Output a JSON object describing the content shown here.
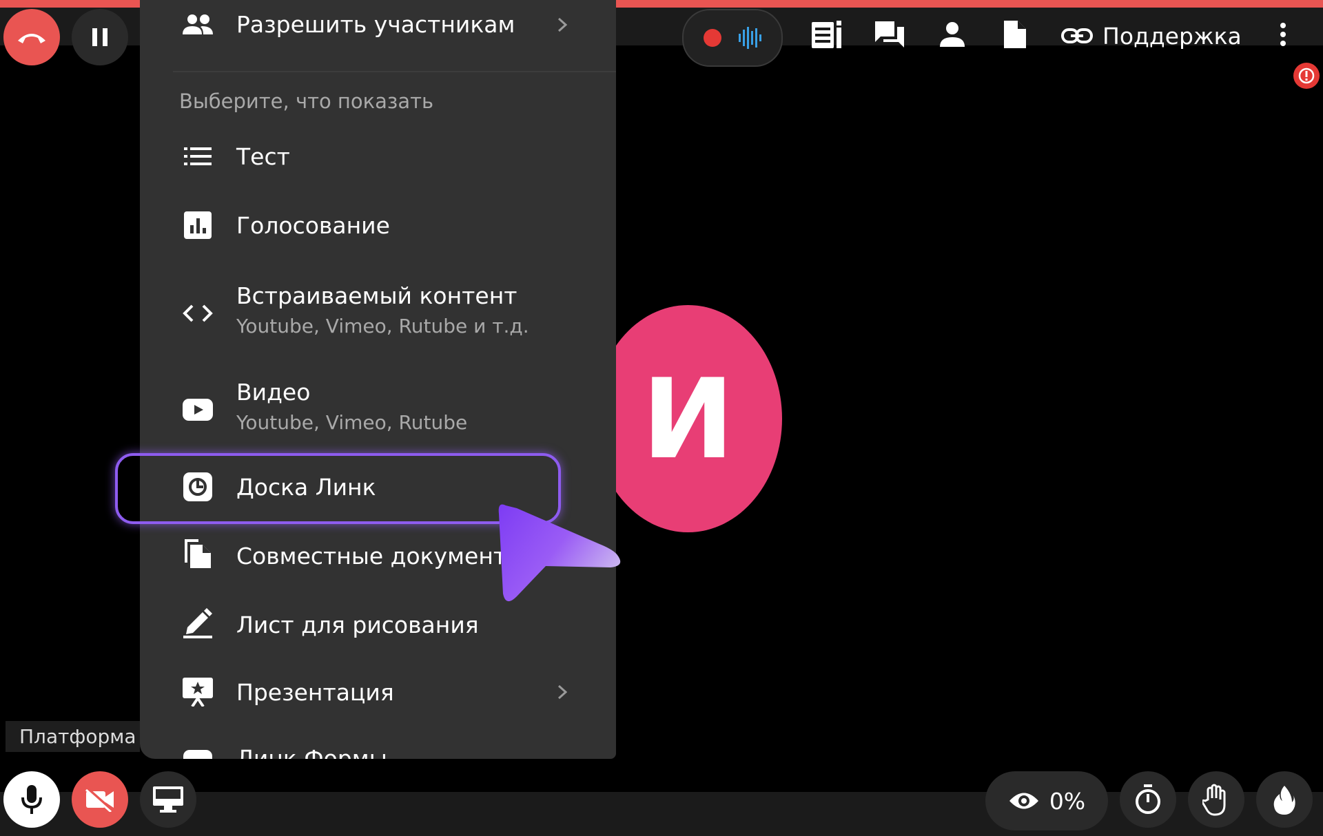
{
  "accent_colors": {
    "end_call": "#e95552",
    "avatar": "#e83e75",
    "highlight": "#8e5cf0",
    "record_dot": "#e53935",
    "audio_wave": "#39a0e6"
  },
  "top_bar": {
    "support_label": "Поддержка",
    "icons": [
      "end-call-icon",
      "pause-icon",
      "record-icon",
      "audio-wave-icon",
      "notes-icon",
      "chat-icon",
      "person-icon",
      "file-icon",
      "link-icon",
      "more-vert-icon"
    ]
  },
  "menu": {
    "allow_participants_label": "Разрешить участникам",
    "section_header": "Выберите, что показать",
    "items": [
      {
        "label": "Тест",
        "icon": "list-icon"
      },
      {
        "label": "Голосование",
        "icon": "poll-icon"
      },
      {
        "label": "Встраиваемый контент",
        "sublabel": "Youtube, Vimeo, Rutube и т.д.",
        "icon": "code-icon"
      },
      {
        "label": "Видео",
        "sublabel": "Youtube, Vimeo, Rutube",
        "icon": "youtube-icon"
      },
      {
        "label": "Доска Линк",
        "icon": "board-icon",
        "highlighted": true
      },
      {
        "label": "Совместные документы",
        "icon": "documents-icon"
      },
      {
        "label": "Лист для рисования",
        "icon": "pencil-icon"
      },
      {
        "label": "Презентация",
        "icon": "presentation-icon"
      },
      {
        "label": "Линк Формы",
        "icon": "form-icon"
      }
    ]
  },
  "participant": {
    "avatar_letter": "И",
    "name_label": "Платформа Л"
  },
  "bottom_bar": {
    "view_percent": "0%",
    "icons": [
      "microphone-icon",
      "camera-off-icon",
      "screen-share-icon",
      "eye-icon",
      "timer-icon",
      "raise-hand-icon",
      "fire-icon"
    ]
  }
}
